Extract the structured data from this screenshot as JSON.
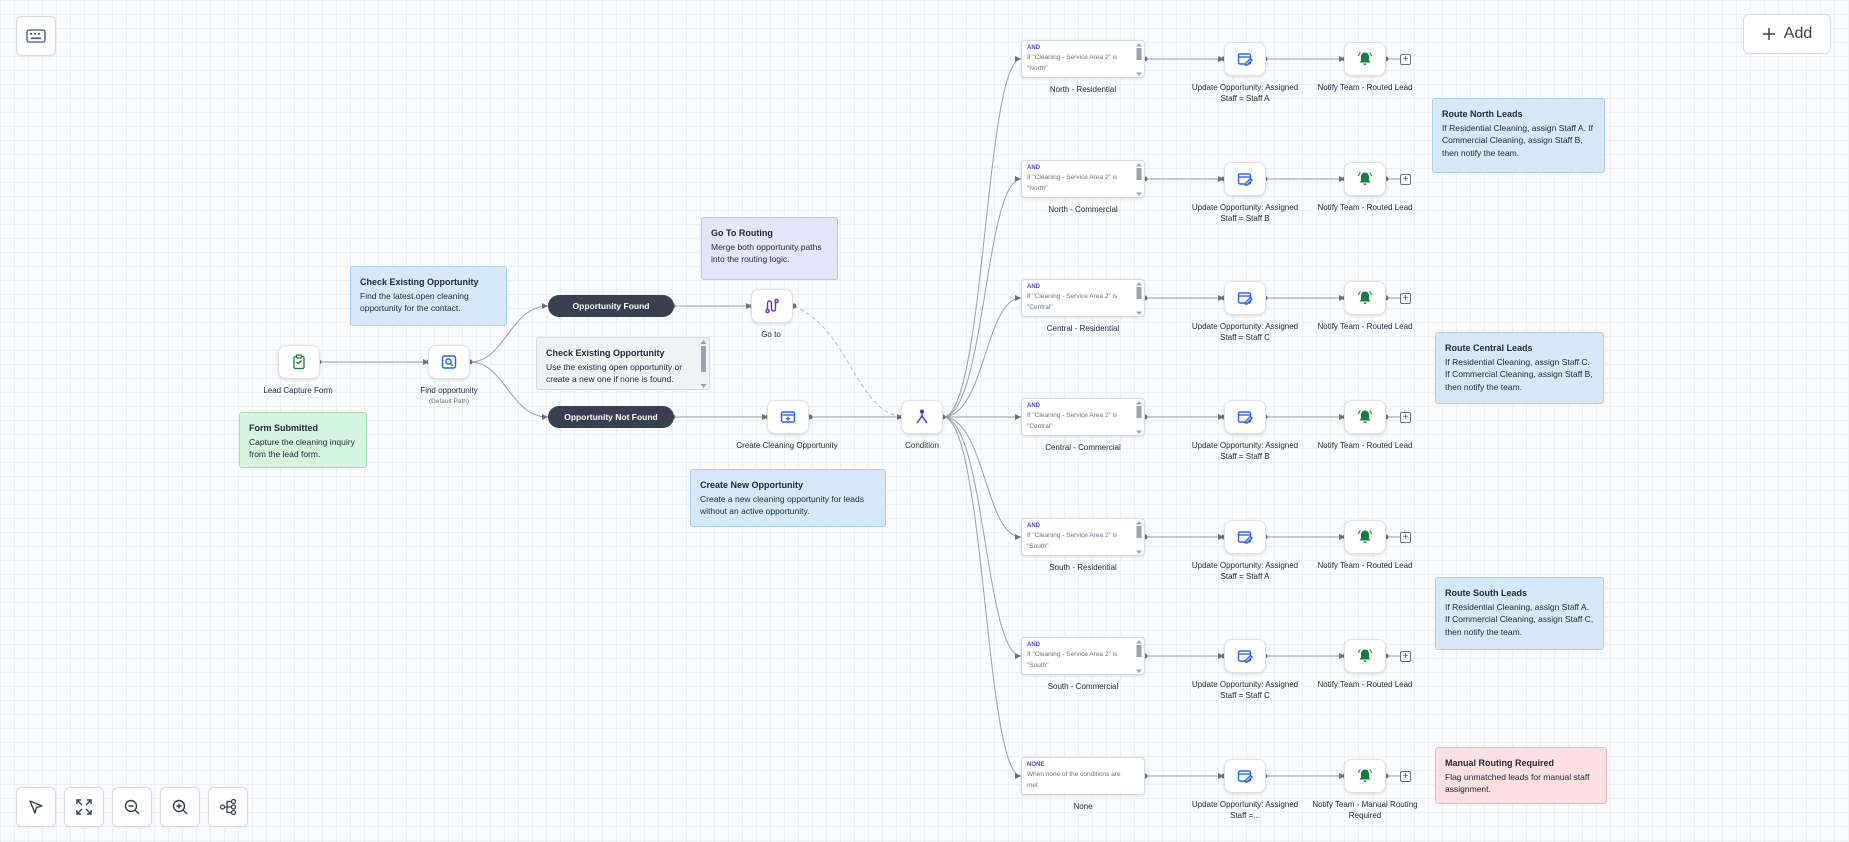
{
  "toolbar": {
    "add_label": "Add"
  },
  "nodes": {
    "lead_capture": {
      "label": "Lead Capture Form",
      "icon": "clipboard-icon"
    },
    "find_opportunity": {
      "label": "Find opportunity",
      "sub": "(Default Path)",
      "icon": "search-icon"
    },
    "opportunity_found": {
      "label": "Opportunity Found"
    },
    "opportunity_not_found": {
      "label": "Opportunity Not Found"
    },
    "goto": {
      "label": "Go to",
      "icon": "route-icon"
    },
    "create_opportunity": {
      "label": "Create Cleaning Opportunity",
      "icon": "add-card-icon"
    },
    "condition": {
      "label": "Condition",
      "icon": "split-icon"
    }
  },
  "branches": [
    {
      "tag": "AND",
      "text": "If \"Cleaning - Service Area 2\" is \"North\"",
      "label": "North - Residential",
      "update": "Update Opportunity: Assigned Staff = Staff A",
      "notify": "Notify Team - Routed Lead"
    },
    {
      "tag": "AND",
      "text": "If \"Cleaning - Service Area 2\" is \"North\"",
      "label": "North - Commercial",
      "update": "Update Opportunity: Assigned Staff = Staff B",
      "notify": "Notify Team - Routed Lead"
    },
    {
      "tag": "AND",
      "text": "If \"Cleaning - Service Area 2\" is \"Central\"",
      "label": "Central - Residential",
      "update": "Update Opportunity: Assigned Staff = Staff C",
      "notify": "Notify Team - Routed Lead"
    },
    {
      "tag": "AND",
      "text": "If \"Cleaning - Service Area 2\" is \"Central\"",
      "label": "Central - Commercial",
      "update": "Update Opportunity: Assigned Staff = Staff B",
      "notify": "Notify Team - Routed Lead"
    },
    {
      "tag": "AND",
      "text": "If \"Cleaning - Service Area 2\" is \"South\"",
      "label": "South - Residential",
      "update": "Update Opportunity: Assigned Staff = Staff A",
      "notify": "Notify Team - Routed Lead"
    },
    {
      "tag": "AND",
      "text": "If \"Cleaning - Service Area 2\" is \"South\"",
      "label": "South - Commercial",
      "update": "Update Opportunity: Assigned Staff = Staff C",
      "notify": "Notify Team - Routed Lead"
    },
    {
      "tag": "NONE",
      "text": "When none of the conditions are met",
      "label": "None",
      "update": "Update Opportunity: Assigned Staff =...",
      "notify": "Notify Team - Manual Routing Required"
    }
  ],
  "notes": {
    "form_submitted": {
      "title": "Form Submitted",
      "body": "Capture the cleaning inquiry from the lead form."
    },
    "check_existing_top": {
      "title": "Check Existing Opportunity",
      "body": "Find the latest open cleaning opportunity for the contact."
    },
    "check_existing_mid": {
      "title": "Check Existing Opportunity",
      "body": "Use the existing open opportunity or create a new one if none is found."
    },
    "go_to_routing": {
      "title": "Go To Routing",
      "body": "Merge both opportunity paths into the routing logic."
    },
    "create_new": {
      "title": "Create New Opportunity",
      "body": "Create a new cleaning opportunity for leads without an active opportunity."
    },
    "route_north": {
      "title": "Route North Leads",
      "body": "If Residential Cleaning, assign Staff A. If Commercial Cleaning, assign Staff B, then notify the team."
    },
    "route_central": {
      "title": "Route Central Leads",
      "body": "If Residential Cleaning, assign Staff C. If Commercial Cleaning, assign Staff B, then notify the team."
    },
    "route_south": {
      "title": "Route South Leads",
      "body": "If Residential Cleaning, assign Staff A. If Commercial Cleaning, assign Staff C, then notify the team."
    },
    "manual_routing": {
      "title": "Manual Routing Required",
      "body": "Flag unmatched leads for manual staff assignment."
    }
  },
  "colors": {
    "accent_blue": "#2563eb",
    "condition_purple": "#6d28d9",
    "notify_green": "#15803d",
    "pill_dark": "#374151"
  }
}
